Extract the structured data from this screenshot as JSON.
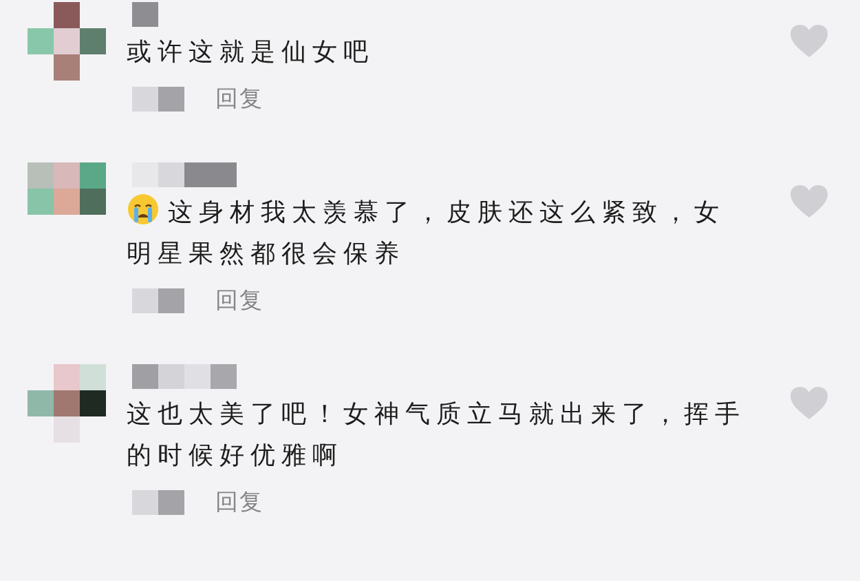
{
  "comments": [
    {
      "has_emoji": false,
      "text": "或许这就是仙女吧",
      "reply": "回复",
      "liked": false
    },
    {
      "has_emoji": true,
      "text": "这身材我太羡慕了，皮肤还这么紧致，女明星果然都很会保养",
      "reply": "回复",
      "liked": false
    },
    {
      "has_emoji": false,
      "text": "这也太美了吧！女神气质立马就出来了，挥手的时候好优雅啊",
      "reply": "回复",
      "liked": false
    }
  ]
}
